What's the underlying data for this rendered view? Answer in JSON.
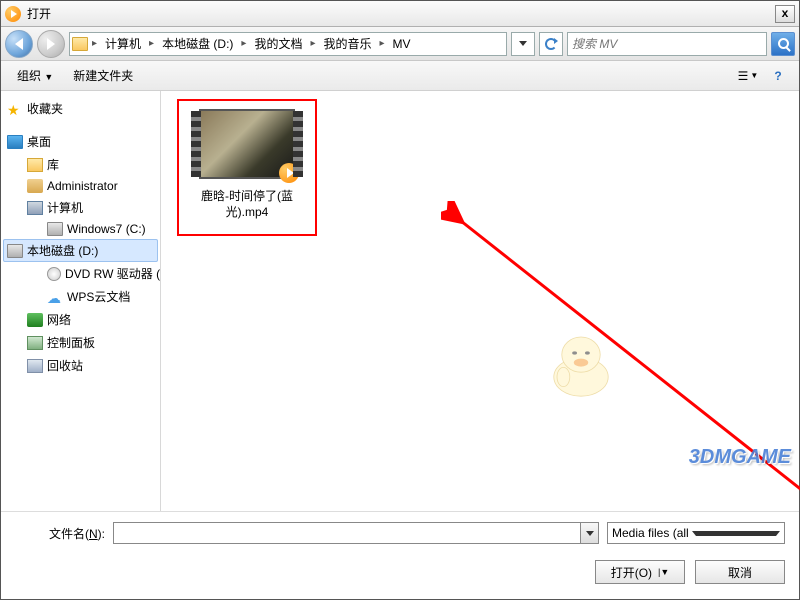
{
  "titlebar": {
    "title": "打开",
    "close": "x"
  },
  "breadcrumb": [
    "计算机",
    "本地磁盘 (D:)",
    "我的文档",
    "我的音乐",
    "MV"
  ],
  "search": {
    "placeholder": "搜索 MV"
  },
  "toolbar": {
    "organize": "组织",
    "newfolder": "新建文件夹"
  },
  "tree": {
    "favorites": "收藏夹",
    "desktop": "桌面",
    "libraries": "库",
    "admin": "Administrator",
    "computer": "计算机",
    "driveC": "Windows7 (C:)",
    "driveD": "本地磁盘 (D:)",
    "dvd": "DVD RW 驱动器 (",
    "wps": "WPS云文档",
    "network": "网络",
    "control": "控制面板",
    "recycle": "回收站"
  },
  "file": {
    "name": "鹿晗-时间停了(蓝光).mp4"
  },
  "bottom": {
    "filename_label_pre": "文件名(",
    "filename_label_key": "N",
    "filename_label_post": "):",
    "filter": "Media files (all types) (*.wmv",
    "open": "打开(O)",
    "cancel": "取消"
  },
  "watermark": "3DMGAME"
}
